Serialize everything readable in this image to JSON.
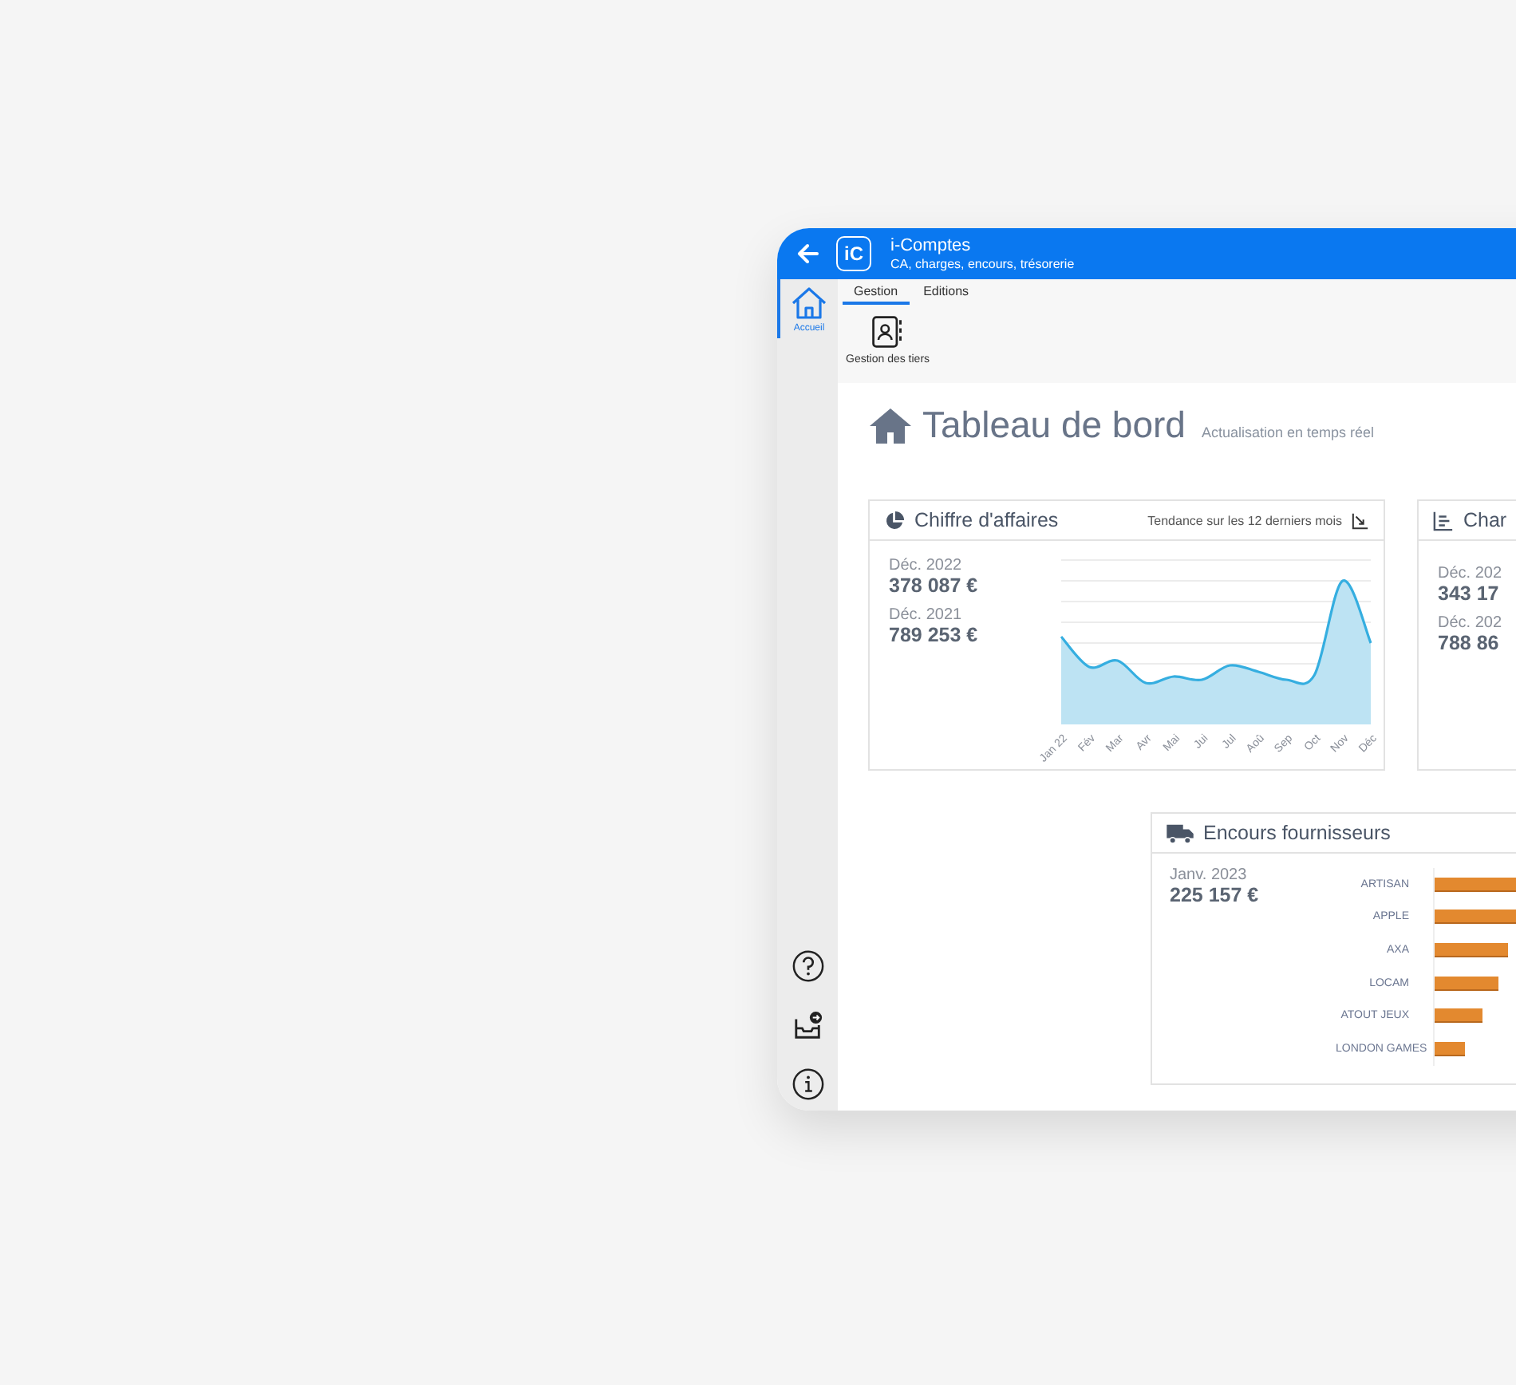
{
  "header": {
    "logo": "iC",
    "title": "i-Comptes",
    "subtitle": "CA, charges, encours, trésorerie"
  },
  "sidebar": {
    "items": [
      {
        "label": "Accueil",
        "selected": true
      }
    ]
  },
  "tabs": [
    {
      "label": "Gestion",
      "selected": true
    },
    {
      "label": "Editions",
      "selected": false
    }
  ],
  "ribbon": {
    "buttons": [
      {
        "label": "Gestion des tiers"
      }
    ]
  },
  "page": {
    "title": "Tableau de bord",
    "subtitle": "Actualisation en temps réel"
  },
  "revenue_card": {
    "title": "Chiffre d'affaires",
    "trend_link": "Tendance sur les 12 derniers mois",
    "figures": [
      {
        "label": "Déc. 2022",
        "value": "378 087 €"
      },
      {
        "label": "Déc. 2021",
        "value": "789 253 €"
      }
    ],
    "months": [
      "Jan 22",
      "Fév",
      "Mar",
      "Avr",
      "Mai",
      "Jui",
      "Jul",
      "Aoû",
      "Sep",
      "Oct",
      "Nov",
      "Déc"
    ]
  },
  "charges_card": {
    "title": "Char",
    "figures": [
      {
        "label": "Déc. 202",
        "value": "343 17"
      },
      {
        "label": "Déc. 202",
        "value": "788 86"
      }
    ]
  },
  "suppliers_card": {
    "title": "Encours fournisseurs",
    "figure": {
      "label": "Janv. 2023",
      "value": "225 157 €"
    },
    "suppliers": [
      {
        "name": "ARTISAN",
        "level": 1
      },
      {
        "name": "APPLE",
        "level": 0.95
      },
      {
        "name": "AXA",
        "level": 0.38
      },
      {
        "name": "LOCAM",
        "level": 0.33
      },
      {
        "name": "ATOUT JEUX",
        "level": 0.25
      },
      {
        "name": "LONDON GAMES",
        "level": 0.16
      }
    ]
  }
}
